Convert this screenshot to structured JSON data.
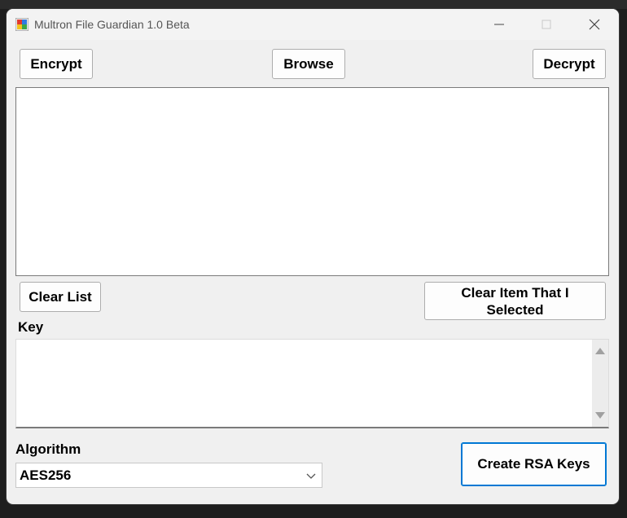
{
  "window": {
    "title": "Multron File Guardian 1.0 Beta"
  },
  "toolbar": {
    "encrypt": "Encrypt",
    "browse": "Browse",
    "decrypt": "Decrypt"
  },
  "file_list": {
    "items": []
  },
  "list_actions": {
    "clear_list": "Clear List",
    "clear_selected": "Clear Item That I Selected"
  },
  "key": {
    "label": "Key",
    "value": ""
  },
  "algorithm": {
    "label": "Algorithm",
    "selected": "AES256"
  },
  "rsa": {
    "create_keys": "Create RSA Keys"
  },
  "colors": {
    "accent": "#0078d4",
    "window_bg": "#f0f0f0"
  }
}
